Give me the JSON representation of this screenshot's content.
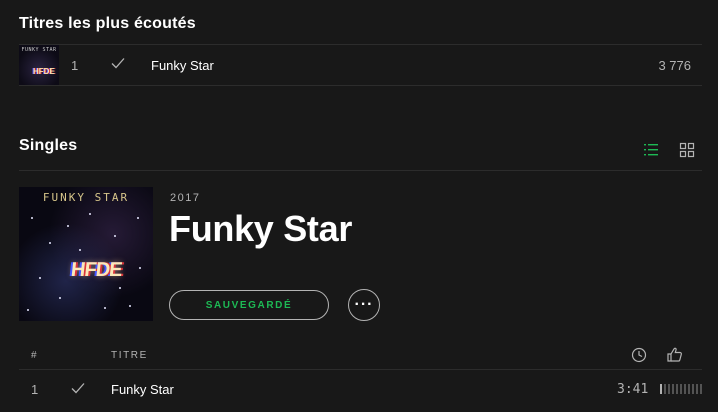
{
  "top_tracks": {
    "heading": "Titres les plus écoutés",
    "items": [
      {
        "number": "1",
        "title": "Funky Star",
        "plays": "3 776",
        "cover_title": "FUNKY STAR",
        "cover_logo": "HFDE",
        "saved_icon": "checkmark-icon"
      }
    ]
  },
  "singles": {
    "heading": "Singles",
    "view_modes": [
      {
        "name": "list",
        "icon": "list-icon",
        "active": true
      },
      {
        "name": "grid",
        "icon": "grid-icon",
        "active": false
      }
    ],
    "release": {
      "year": "2017",
      "title": "Funky Star",
      "cover_title": "FUNKY STAR",
      "cover_logo": "HFDE",
      "saved_label": "SAUVEGARDÉ",
      "more_label": "···",
      "columns": {
        "number": "#",
        "title": "TITRE",
        "duration_icon": "clock-icon",
        "popularity_icon": "thumbs-up-icon"
      },
      "tracks": [
        {
          "number": "1",
          "title": "Funky Star",
          "duration": "3:41",
          "popularity": 0.1,
          "saved_icon": "checkmark-icon"
        }
      ]
    }
  },
  "colors": {
    "background": "#181818",
    "accent": "#1db954",
    "muted_text": "#b3b3b3",
    "divider": "#2c2c2c"
  }
}
